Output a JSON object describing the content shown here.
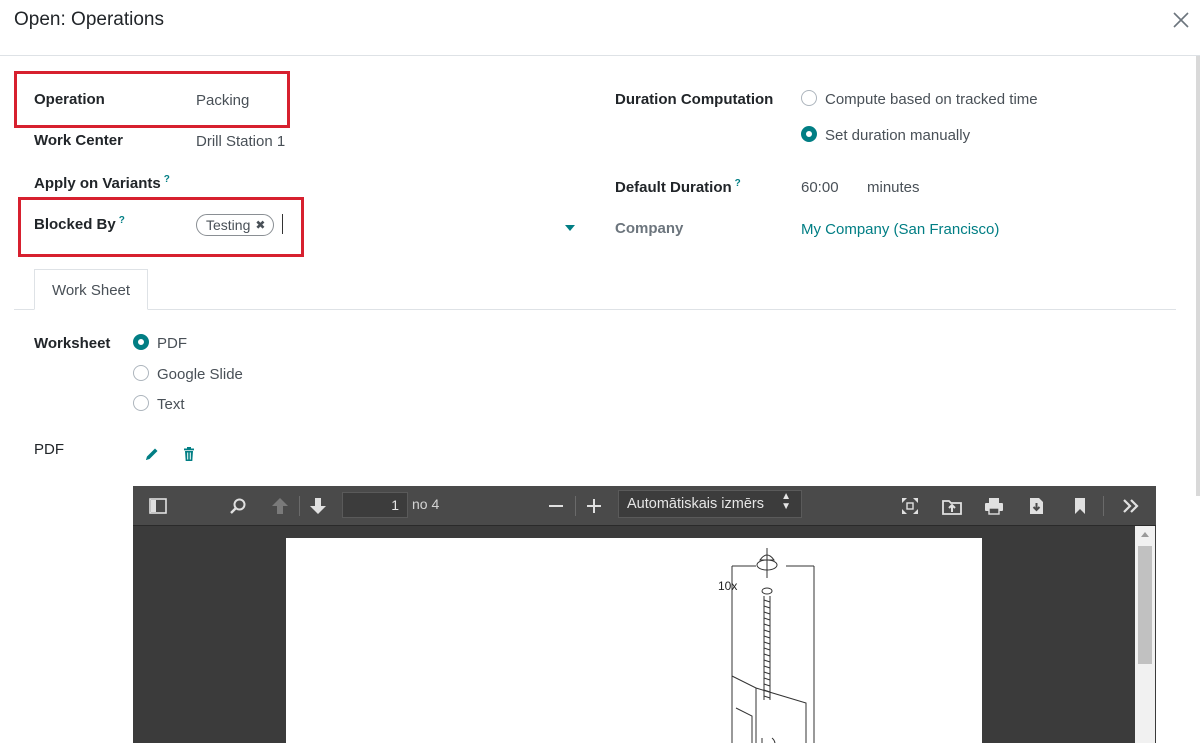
{
  "dialog": {
    "title": "Open: Operations"
  },
  "form": {
    "operation": {
      "label": "Operation",
      "value": "Packing"
    },
    "work_center": {
      "label": "Work Center",
      "value": "Drill Station 1"
    },
    "apply_on_variants": {
      "label": "Apply on Variants",
      "help": "?"
    },
    "blocked_by": {
      "label": "Blocked By",
      "help": "?",
      "tags": [
        "Testing"
      ]
    },
    "duration_computation": {
      "label": "Duration Computation",
      "options": [
        "Compute based on tracked time",
        "Set duration manually"
      ],
      "selected": "Set duration manually"
    },
    "default_duration": {
      "label": "Default Duration",
      "help": "?",
      "value": "60:00",
      "unit": "minutes"
    },
    "company": {
      "label": "Company",
      "value": "My Company (San Francisco)"
    }
  },
  "tabs": [
    {
      "label": "Work Sheet",
      "active": true
    }
  ],
  "worksheet": {
    "label": "Worksheet",
    "options": [
      "PDF",
      "Google Slide",
      "Text"
    ],
    "selected": "PDF"
  },
  "pdf": {
    "label": "PDF",
    "viewer": {
      "page_number": "1",
      "page_of": "no 4",
      "zoom": "Automātiskais izmērs",
      "drawing_label": "10x"
    }
  },
  "colors": {
    "accent": "#017e84",
    "highlight": "#d7202f"
  }
}
